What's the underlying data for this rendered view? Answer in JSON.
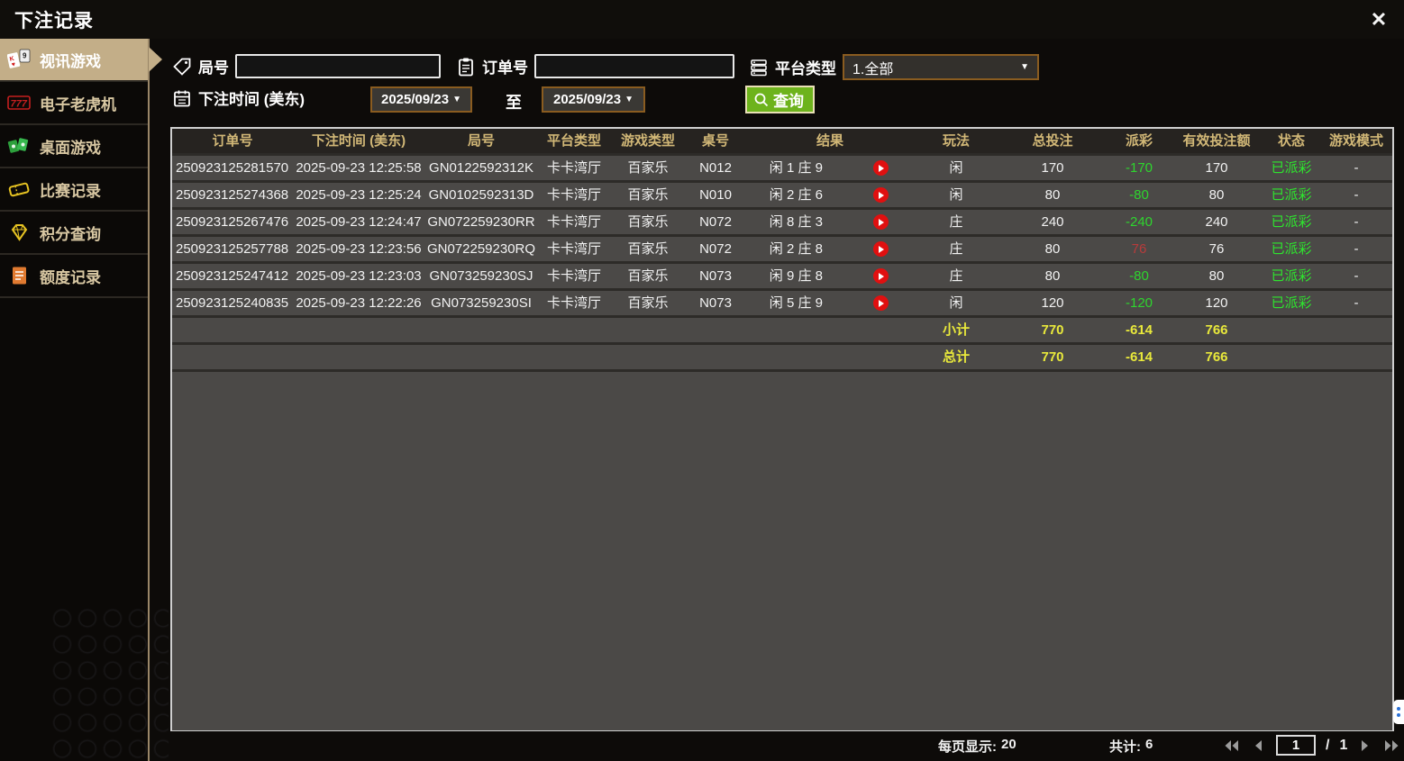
{
  "title": "下注记录",
  "icons": {
    "close": "✕",
    "dropdown_arrow": "▼"
  },
  "sidebar": {
    "items": [
      {
        "label": "视讯游戏",
        "icon": "cards-icon",
        "active": true
      },
      {
        "label": "电子老虎机",
        "icon": "slots-777-icon",
        "active": false
      },
      {
        "label": "桌面游戏",
        "icon": "table-games-icon",
        "active": false
      },
      {
        "label": "比赛记录",
        "icon": "ticket-icon",
        "active": false
      },
      {
        "label": "积分查询",
        "icon": "diamond-icon",
        "active": false
      },
      {
        "label": "额度记录",
        "icon": "document-icon",
        "active": false
      }
    ]
  },
  "filters": {
    "round_label": "局号",
    "round_value": "",
    "order_label": "订单号",
    "order_value": "",
    "platform_label": "平台类型",
    "platform_value": "1.全部",
    "bet_time_label": "下注时间 (美东)",
    "date_from": "2025/09/23",
    "to_label": "至",
    "date_to": "2025/09/23",
    "query_label": "查询"
  },
  "table": {
    "headers": [
      "订单号",
      "下注时间 (美东)",
      "局号",
      "平台类型",
      "游戏类型",
      "桌号",
      "结果",
      "玩法",
      "总投注",
      "派彩",
      "有效投注额",
      "状态",
      "游戏模式"
    ],
    "rows": [
      [
        "250923125281570",
        "2025-09-23 12:25:58",
        "GN0122592312K",
        "卡卡湾厅",
        "百家乐",
        "N012",
        "闲 1 庄 9",
        "闲",
        "170",
        "-170",
        "170",
        "已派彩",
        "-"
      ],
      [
        "250923125274368",
        "2025-09-23 12:25:24",
        "GN0102592313D",
        "卡卡湾厅",
        "百家乐",
        "N010",
        "闲 2 庄 6",
        "闲",
        "80",
        "-80",
        "80",
        "已派彩",
        "-"
      ],
      [
        "250923125267476",
        "2025-09-23 12:24:47",
        "GN072259230RR",
        "卡卡湾厅",
        "百家乐",
        "N072",
        "闲 8 庄 3",
        "庄",
        "240",
        "-240",
        "240",
        "已派彩",
        "-"
      ],
      [
        "250923125257788",
        "2025-09-23 12:23:56",
        "GN072259230RQ",
        "卡卡湾厅",
        "百家乐",
        "N072",
        "闲 2 庄 8",
        "庄",
        "80",
        "76",
        "76",
        "已派彩",
        "-"
      ],
      [
        "250923125247412",
        "2025-09-23 12:23:03",
        "GN073259230SJ",
        "卡卡湾厅",
        "百家乐",
        "N073",
        "闲 9 庄 8",
        "庄",
        "80",
        "-80",
        "80",
        "已派彩",
        "-"
      ],
      [
        "250923125240835",
        "2025-09-23 12:22:26",
        "GN073259230SI",
        "卡卡湾厅",
        "百家乐",
        "N073",
        "闲 5 庄 9",
        "闲",
        "120",
        "-120",
        "120",
        "已派彩",
        "-"
      ]
    ],
    "subtotal": {
      "label": "小计",
      "total_bet": "770",
      "payout": "-614",
      "valid_bet": "766"
    },
    "grand_total": {
      "label": "总计",
      "total_bet": "770",
      "payout": "-614",
      "valid_bet": "766"
    }
  },
  "pagination": {
    "per_page_label": "每页显示:",
    "per_page_value": "20",
    "total_label": "共计:",
    "total_value": "6",
    "page": "1",
    "page_separator": "/",
    "total_pages": "1"
  },
  "colors": {
    "accent_green": "#6db31c",
    "header_gold": "#d2b877",
    "total_yellow": "#e9e93b",
    "win_red": "#b83b3b",
    "loss_green": "#2ed52e",
    "status_green": "#2ee52e",
    "active_tab_tan": "#c3ae88",
    "date_border_brown": "#8a5c20",
    "play_red": "#e01010"
  }
}
